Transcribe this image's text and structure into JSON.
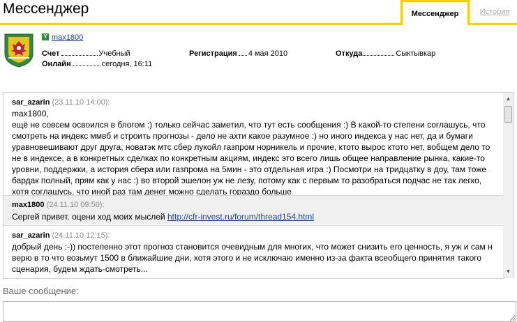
{
  "header": {
    "title": "Мессенджер",
    "tabs": [
      {
        "label": "Мессенджер"
      },
      {
        "label": "История"
      }
    ],
    "accent_color": "#ffcc00"
  },
  "profile": {
    "badge": "Y",
    "username": "max1800",
    "account_label": "Счет",
    "account_value": "Учебный",
    "online_label": "Онлайн",
    "online_value": "сегодня, 16:11",
    "registration_label": "Регистрация",
    "registration_value": "4 мая 2010",
    "from_label": "Откуда",
    "from_value": "Сыктывкар"
  },
  "messages": [
    {
      "author": "sar_azarin",
      "time": "(23.11.10 14:00):",
      "lines": [
        "max1800,",
        "ещё не совсем освоился в блогом :) только сейчас заметил, что тут есть сообщения :) В какой-то степени соглашусь, что",
        "смотреть на индекс ммвб и строить прогнозы - дело не ахти какое разумное :) но иного индекса у нас нет, да и бумаги",
        "уравновешивают друг друга, новатэк мтс сбер лукойл газпром норникель и прочие, ктото вырос ктото нет, вобщем дело то",
        "не в индексе, а в конкретных сделках по конкретным акциям, индекс это всего лишь общее направление рынка, какие-то",
        "уровни, поддержки, а история сбера или газпрома на 5мин - это отдельная игра :) Посмотри на тридцатку в доу, там тоже",
        "бардак полный, прям как у нас :) во второй эшелон уж не лезу, потому как с первым то разобраться подчас не так легко,",
        "хотя соглашусь, что иной раз там денег можно сделать гораздо больше"
      ]
    },
    {
      "author": "max1800",
      "time": "(24.11.10 09:50):",
      "text_prefix": "Сергей привет. оцени ход моих мыслей ",
      "link": "http://cfr-invest.ru/forum/thread154.html"
    },
    {
      "author": "sar_azarin",
      "time": "(24.11.10 12:15):",
      "lines": [
        "добрый день :-)) постепенно этот прогноз становится очевидным для многих, что может снизить его ценность, я уж и сам н",
        "верю в то что возьмут 1500 в ближайшие дни, хотя этого и не исключаю именно из-за факта всеобщего принятия такого",
        "сценария, будем ждать-смотреть..."
      ]
    }
  ],
  "reply": {
    "label": "Ваше сообщение:",
    "value": ""
  }
}
